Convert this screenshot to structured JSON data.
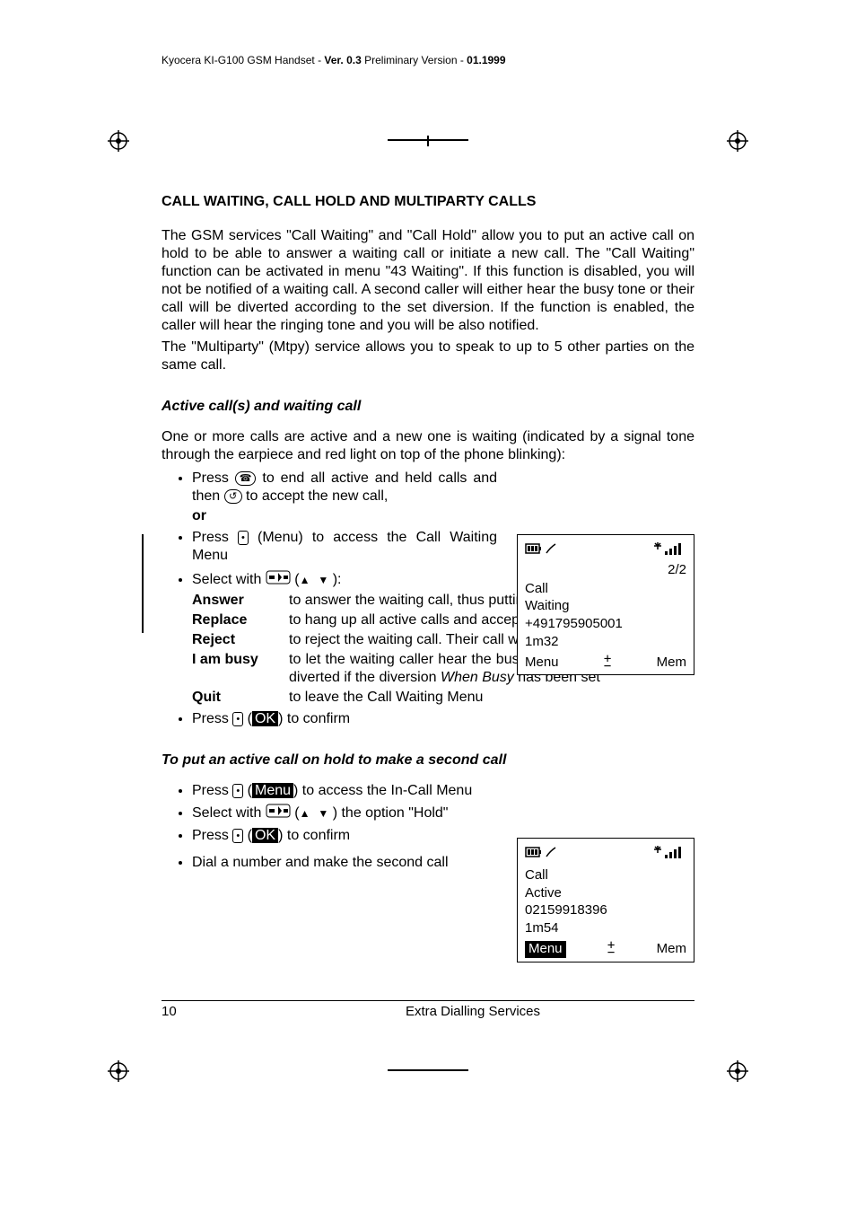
{
  "header": {
    "product": "Kyocera KI-G100 GSM Handset - ",
    "ver_label": "Ver. 0.3",
    "tail": " Preliminary Version - ",
    "date": "01.1999"
  },
  "section_title": "CALL WAITING, CALL HOLD AND MULTIPARTY CALLS",
  "para1": "The GSM services \"Call Waiting\" and \"Call Hold\" allow you to put an active call on hold to be able to answer a waiting call or initiate a new call. The \"Call Waiting\" function can be activated in menu \"43 Waiting\". If this function is disabled, you will not be notified of a waiting call. A second caller will either hear the busy tone or their call will be diverted according to the set diversion. If the function is enabled, the caller will hear the ringing tone and you will be also notified.",
  "para2": "The \"Multiparty\" (Mtpy) service allows you to speak to up to 5 other parties on the same call.",
  "sub1": "Active call(s) and waiting call",
  "para3": "One or more calls are active and a new one is waiting (indicated by a signal tone through the earpiece and red light on top of the phone blinking):",
  "b1a": "Press ",
  "b1b": " to end all active and held calls and then ",
  "b1c": " to accept the new call,",
  "or": "or",
  "b2a": "Press ",
  "b2b": " (Menu) to access the Call Waiting Menu",
  "b3a": "Select with ",
  "b3b": " (",
  "b3c": " ):",
  "defs": {
    "answer": {
      "t": "Answer",
      "d": "to answer the waiting call, thus putting on hold the active ones"
    },
    "replace": {
      "t": "Replace",
      "d": "to hang up all active calls and accept the new one"
    },
    "reject": {
      "t": "Reject",
      "d": "to reject the waiting call. Their call will be dropped."
    },
    "busy": {
      "t": "I am busy",
      "d1": "to let the waiting caller hear the busy tone or let their call being diverted if the diversion ",
      "d_em": "When Busy",
      "d2": " has been set"
    },
    "quit": {
      "t": "Quit",
      "d": "to leave the Call Waiting Menu"
    }
  },
  "b4a": "Press ",
  "b4b": " (",
  "b4_ok": "OK",
  "b4c": ") to confirm",
  "sub2": "To put an active call on hold to make a second call",
  "c1a": "Press ",
  "c1b": " (",
  "c1_menu": "Menu",
  "c1c": ") to access the In-Call Menu",
  "c2a": "Select with ",
  "c2b": " (",
  "c2c": " ) the option \"Hold\"",
  "c3a": "Press ",
  "c3b": " (",
  "c3_ok": "OK",
  "c3c": ") to confirm",
  "c4": "Dial a number and make the second call",
  "phone1": {
    "counter": "2/2",
    "l1": "Call",
    "l2": "Waiting",
    "l3": "+491795905001",
    "l4": "1m32",
    "left": "Menu",
    "right": "Mem"
  },
  "phone2": {
    "l1": "Call",
    "l2": "Active",
    "l3": "02159918396",
    "l4": "1m54",
    "left": "Menu",
    "right": "Mem"
  },
  "footer": {
    "page": "10",
    "title": "Extra Dialling Services"
  }
}
